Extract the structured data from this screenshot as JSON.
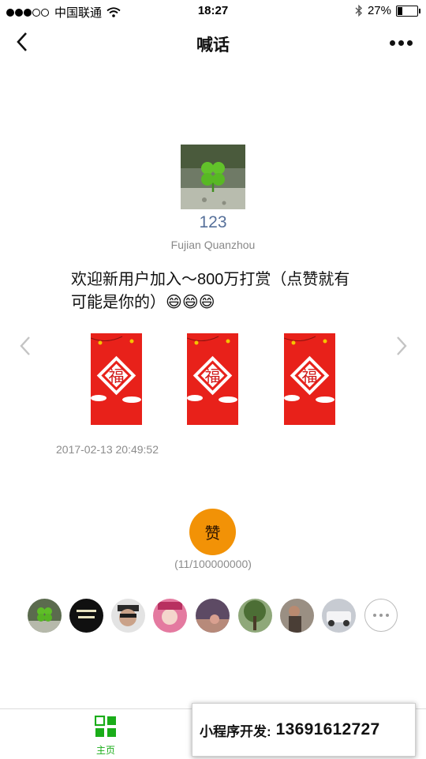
{
  "status_bar": {
    "carrier": "中国联通",
    "time": "18:27",
    "battery_text": "27%",
    "battery_level": 0.27
  },
  "nav": {
    "title": "喊话",
    "back_icon": "chevron-left-icon",
    "more_icon": "more-dots-icon"
  },
  "post": {
    "username": "123",
    "location": "Fujian Quanzhou",
    "message": "欢迎新用户加入～800万打赏（点赞就有可能是你的）😄😄😄",
    "red_packets": [
      {
        "glyph": "福"
      },
      {
        "glyph": "福"
      },
      {
        "glyph": "福"
      }
    ],
    "timestamp": "2017-02-13 20:49:52",
    "like_button": "赞",
    "like_count": "(11/100000000)"
  },
  "likers_more_icon": "more-horizontal-icon",
  "tabbar": {
    "home_label": "主页",
    "home_icon": "grid-icon"
  },
  "promo": {
    "label": "小程序开发:",
    "phone": "13691612727"
  },
  "colors": {
    "accent_green": "#1aad19",
    "like_orange": "#f29206",
    "packet_red": "#e8211a",
    "username_blue": "#56709a"
  }
}
